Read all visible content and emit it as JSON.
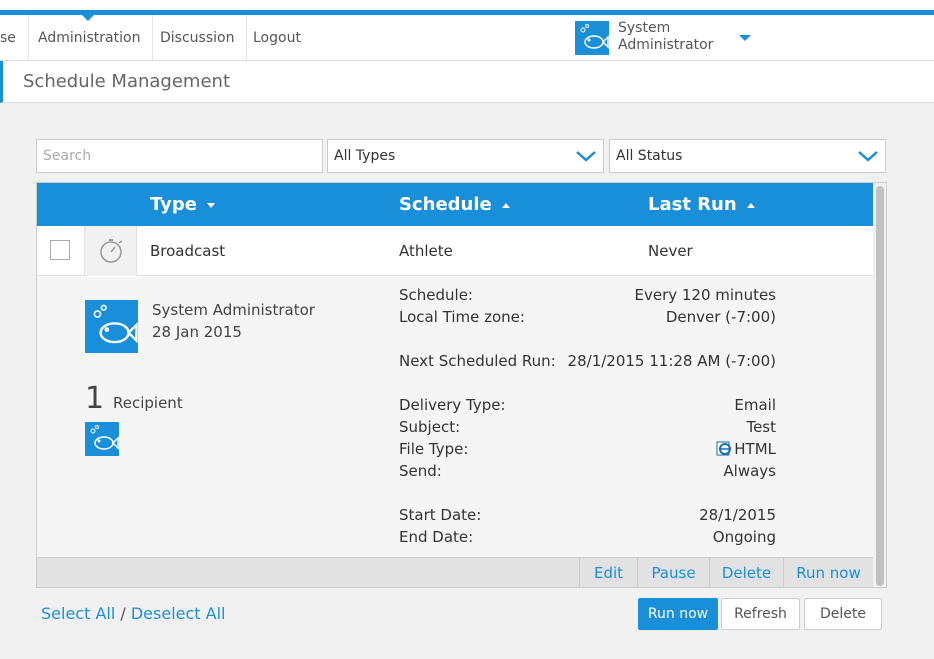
{
  "nav": {
    "partial_item": "se",
    "items": [
      "Administration",
      "Discussion",
      "Logout"
    ],
    "user_line1": "System",
    "user_line2": "Administrator"
  },
  "page_title": "Schedule Management",
  "filters": {
    "search_placeholder": "Search",
    "type_select": "All Types",
    "status_select": "All Status"
  },
  "table": {
    "columns": [
      "Type",
      "Schedule",
      "Last Run"
    ],
    "row": {
      "type": "Broadcast",
      "schedule": "Athlete",
      "last_run": "Never"
    },
    "details": {
      "creator": "System Administrator",
      "created_date": "28 Jan 2015",
      "recipient_count": "1",
      "recipient_label": "Recipient",
      "fields": [
        {
          "label": "Schedule:",
          "value": "Every 120 minutes"
        },
        {
          "label": "Local Time zone:",
          "value": "Denver (-7:00)"
        },
        {
          "label": "Next Scheduled Run:",
          "value": "28/1/2015 11:28 AM (-7:00)"
        },
        {
          "label": "Delivery Type:",
          "value": "Email"
        },
        {
          "label": "Subject:",
          "value": "Test"
        },
        {
          "label": "File Type:",
          "value": "HTML"
        },
        {
          "label": "Send:",
          "value": "Always"
        },
        {
          "label": "Start Date:",
          "value": "28/1/2015"
        },
        {
          "label": "End Date:",
          "value": "Ongoing"
        }
      ]
    },
    "row_actions": [
      "Edit",
      "Pause",
      "Delete",
      "Run now"
    ]
  },
  "footer": {
    "select_all": "Select All",
    "separator": "/",
    "deselect_all": "Deselect All",
    "run_now": "Run now",
    "refresh": "Refresh",
    "delete": "Delete"
  },
  "colors": {
    "accent": "#1a8fd9"
  }
}
